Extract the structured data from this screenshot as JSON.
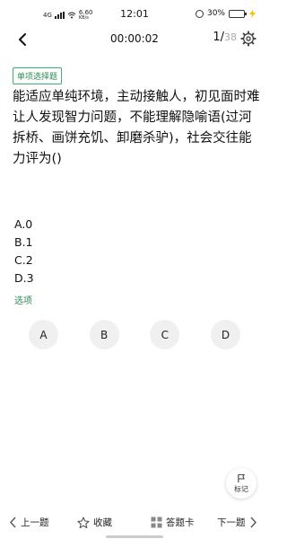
{
  "status_bar": {
    "network": "4G",
    "speed": "6.60",
    "speed_unit": "KB/s",
    "time": "12:01",
    "battery": "30%",
    "battery_level": 0.3
  },
  "header": {
    "timer": "00:00:02",
    "progress_current": "1/",
    "progress_total": "38"
  },
  "question": {
    "type_label": "单项选择题",
    "text": "能适应单纯环境，主动接触人，初见面时难让人发现智力问题，不能理解隐喻语(过河拆桥、画饼充饥、卸磨杀驴)，社会交往能力评为()",
    "options": [
      "A.0",
      "B.1",
      "C.2",
      "D.3"
    ]
  },
  "answer_section": {
    "label": "选项",
    "choices": [
      "A",
      "B",
      "C",
      "D"
    ]
  },
  "mark_button": {
    "label": "标记"
  },
  "bottom_nav": {
    "prev_label": "上一题",
    "favorite_label": "收藏",
    "answer_card_label": "答题卡",
    "next_label": "下一题"
  },
  "colors": {
    "accent_green": "#2e8b57",
    "battery_green": "#4caf50"
  },
  "icons": [
    "back-arrow-icon",
    "settings-gear-icon",
    "flag-icon",
    "star-icon",
    "grid-icon",
    "chevron-left-icon",
    "chevron-right-icon"
  ]
}
